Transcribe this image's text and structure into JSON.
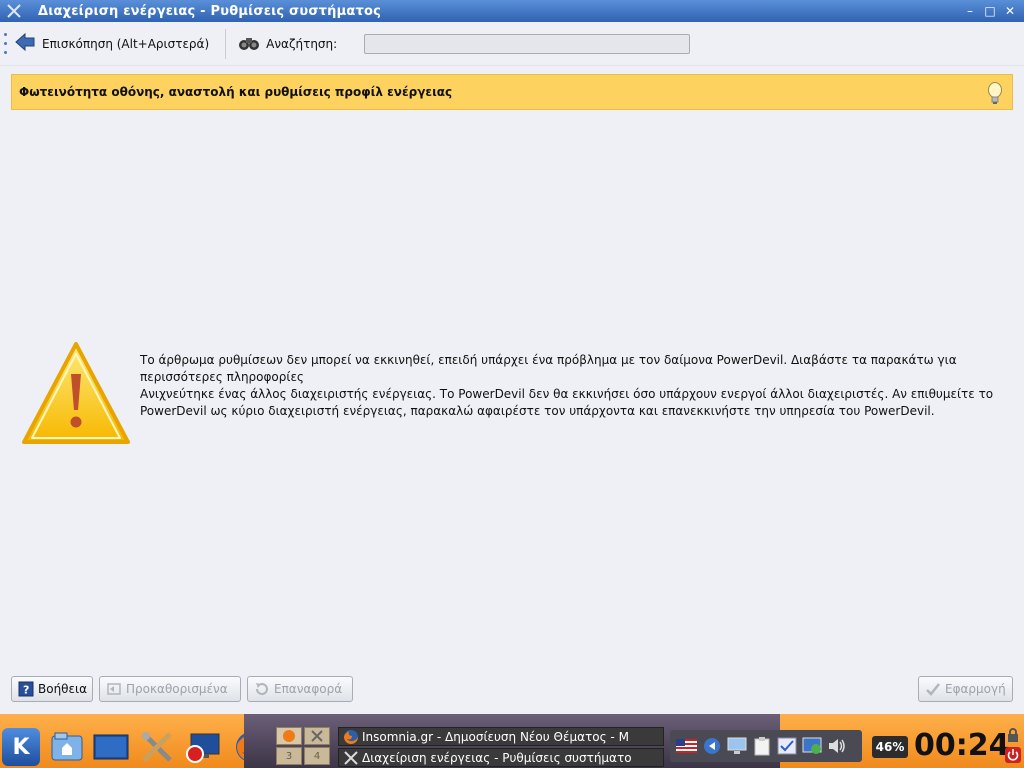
{
  "window": {
    "title": "Διαχείριση ενέργειας - Ρυθμίσεις συστήματος",
    "controls": [
      "minimize-icon",
      "maximize-icon",
      "close-icon"
    ]
  },
  "toolbar": {
    "overview_label": "Επισκόπηση (Alt+Αριστερά)",
    "search_label": "Αναζήτηση:",
    "search_value": "",
    "search_placeholder": ""
  },
  "banner": {
    "title": "Φωτεινότητα οθόνης, αναστολή και ρυθμίσεις προφίλ ενέργειας",
    "icon": "lightbulb-icon"
  },
  "messages": {
    "line1": "Το άρθρωμα ρυθμίσεων δεν μπορεί να εκκινηθεί, επειδή υπάρχει ένα πρόβλημα με τον δαίμονα PowerDevil. Διαβάστε τα παρακάτω για περισσότερες πληροφορίες",
    "line2": "Ανιχνεύτηκε ένας άλλος διαχειριστής ενέργειας. Το PowerDevil δεν θα εκκινήσει όσο υπάρχουν ενεργοί άλλοι διαχειριστές. Αν επιθυμείτε το PowerDevil ως κύριο διαχειριστή ενέργειας, παρακαλώ αφαιρέστε τον υπάρχοντα και επανεκκινήστε την υπηρεσία του PowerDevil."
  },
  "buttons": {
    "help": "Βοήθεια",
    "defaults": "Προκαθορισμένα",
    "reset": "Επαναφορά",
    "apply": "Εφαρμογή"
  },
  "taskbar": {
    "pager": [
      "1",
      "2",
      "3",
      "4"
    ],
    "tasks": [
      "Insomnia.gr - Δημοσίευση Νέου Θέματος - M",
      "Διαχείριση ενέργειας - Ρυθμίσεις συστήματο"
    ],
    "battery": "46%",
    "clock": "00:24",
    "keyboard_layout": "US"
  },
  "colors": {
    "titlebar": "#2f63b3",
    "banner": "#fdd25f",
    "taskbar": "#f08a1c"
  }
}
